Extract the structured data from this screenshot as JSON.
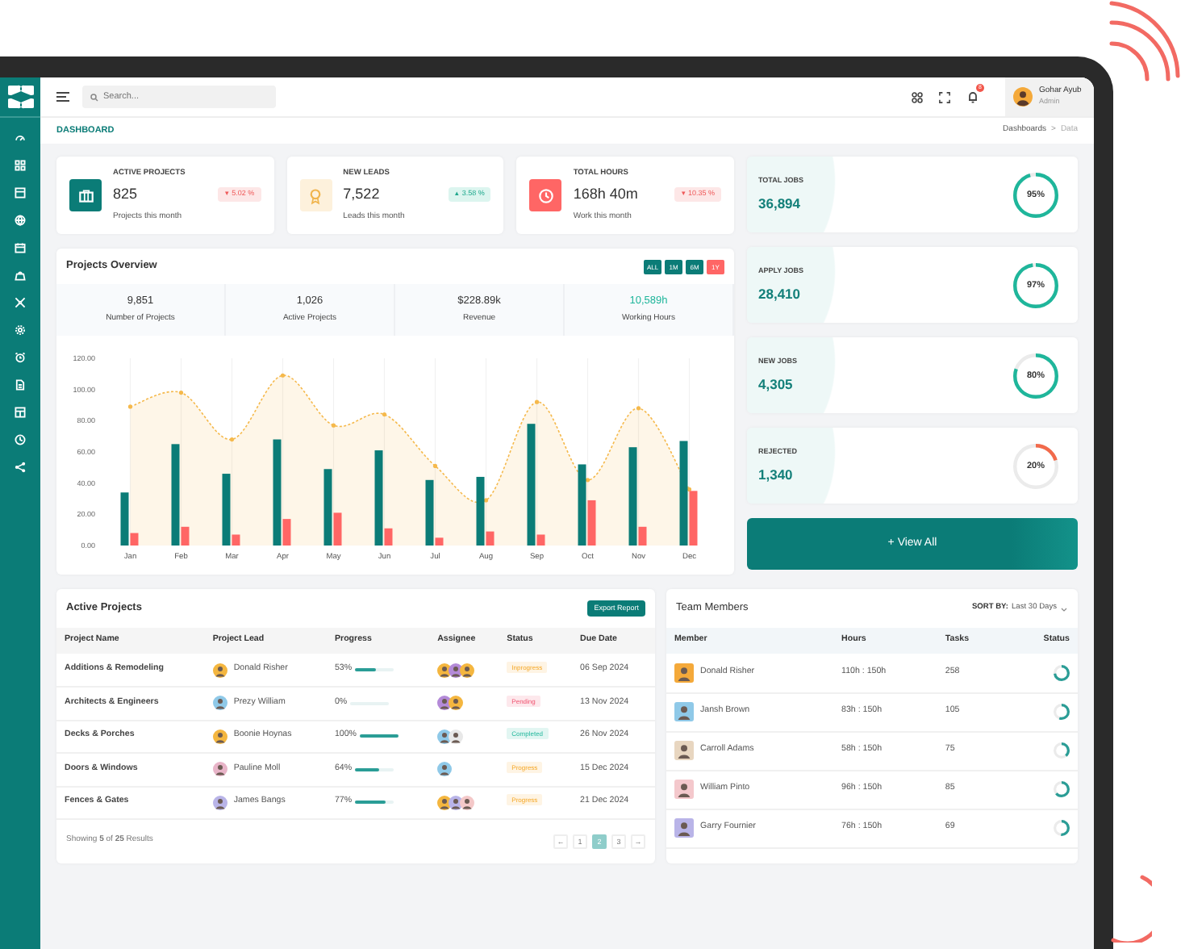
{
  "header": {
    "search": {
      "placeholder": "Search..."
    },
    "notification_badge": "8",
    "user": {
      "name": "Gohar Ayub",
      "role": "Admin"
    }
  },
  "breadcrumb": {
    "title": "DASHBOARD",
    "trail": [
      {
        "label": "Dashboards",
        "current": false
      },
      {
        "label": "Data",
        "current": true
      }
    ],
    "separator": ">"
  },
  "stat_cards": [
    {
      "title": "ACTIVE PROJECTS",
      "value": "825",
      "caption": "Projects this month",
      "change": "▾ 5.02 %",
      "kind": "down",
      "color": "#0b7c77"
    },
    {
      "title": "NEW LEADS",
      "value": "7,522",
      "caption": "Leads this month",
      "change": "▴ 3.58 %",
      "kind": "up",
      "color": "#fdf1dc"
    },
    {
      "title": "TOTAL HOURS",
      "value": "168h 40m",
      "caption": "Work this month",
      "change": "▾ 10.35 %",
      "kind": "down",
      "color": "#ff6665"
    }
  ],
  "projects_overview": {
    "title": "Projects Overview",
    "ranges": [
      {
        "label": "ALL",
        "selected": false
      },
      {
        "label": "1M",
        "selected": false
      },
      {
        "label": "6M",
        "selected": false
      },
      {
        "label": "1Y",
        "selected": true
      }
    ],
    "summary": [
      {
        "value": "9,851",
        "label": "Number of Projects",
        "highlight": false
      },
      {
        "value": "1,026",
        "label": "Active Projects",
        "highlight": false
      },
      {
        "value": "$228.89k",
        "label": "Revenue",
        "highlight": false
      },
      {
        "value": "10,589h",
        "label": "Working Hours",
        "highlight": true
      }
    ],
    "chart_data": {
      "type": "bar",
      "grid": true,
      "categories": [
        "Jan",
        "Feb",
        "Mar",
        "Apr",
        "May",
        "Jun",
        "Jul",
        "Aug",
        "Sep",
        "Oct",
        "Nov",
        "Dec"
      ],
      "ylim": [
        0,
        120
      ],
      "yticks": [
        {
          "value": 0,
          "label": "0.00"
        },
        {
          "value": 20,
          "label": "20.00"
        },
        {
          "value": 40,
          "label": "40.00"
        },
        {
          "value": 60,
          "label": "60.00"
        },
        {
          "value": 80,
          "label": "80.00"
        },
        {
          "value": 100,
          "label": "100.00"
        },
        {
          "value": 120,
          "label": "120.00"
        }
      ],
      "series": [
        {
          "type": "area",
          "color": "#f5b94c",
          "values": [
            89,
            98,
            68,
            109,
            77,
            84,
            51,
            29,
            92,
            42,
            88,
            36
          ]
        },
        {
          "type": "bar",
          "color": "#0b7c77",
          "values": [
            34,
            65,
            46,
            68,
            49,
            61,
            42,
            44,
            78,
            52,
            63,
            67
          ]
        },
        {
          "type": "bar",
          "color": "#ff6665",
          "values": [
            8,
            12,
            7,
            17,
            21,
            11,
            5,
            9,
            7,
            29,
            12,
            35
          ]
        }
      ]
    }
  },
  "job_cards": [
    {
      "title": "TOTAL JOBS",
      "value": "36,894",
      "percent": "95%",
      "level": 0.95,
      "color": "#1fb69b"
    },
    {
      "title": "APPLY JOBS",
      "value": "28,410",
      "percent": "97%",
      "level": 0.97,
      "color": "#1fb69b"
    },
    {
      "title": "NEW JOBS",
      "value": "4,305",
      "percent": "80%",
      "level": 0.8,
      "color": "#1fb69b"
    },
    {
      "title": "REJECTED",
      "value": "1,340",
      "percent": "20%",
      "level": 0.2,
      "color": "#f26a4b"
    }
  ],
  "view_all_button": "+ View All",
  "active_projects": {
    "title": "Active Projects",
    "export_button": "Export Report",
    "columns": [
      "Project Name",
      "Project Lead",
      "Progress",
      "Assignee",
      "Status",
      "Due Date"
    ],
    "rows": [
      {
        "name": "Additions & Remodeling",
        "lead": {
          "name": "Donald Risher",
          "color": "#f4b63f"
        },
        "progress": "53%",
        "level": 0.53,
        "assignees": [
          {
            "color": "#f4b63f"
          },
          {
            "color": "#b48ad8"
          },
          {
            "color": "#f4b63f"
          }
        ],
        "status": {
          "label": "Inprogress",
          "kind": "progress"
        },
        "due": "06 Sep 2024"
      },
      {
        "name": "Architects & Engineers",
        "lead": {
          "name": "Prezy William",
          "color": "#8fc9e8"
        },
        "progress": "0%",
        "level": 0,
        "assignees": [
          {
            "color": "#b48ad8"
          },
          {
            "color": "#f4b63f"
          }
        ],
        "status": {
          "label": "Pending",
          "kind": "pending"
        },
        "due": "13 Nov 2024"
      },
      {
        "name": "Decks & Porches",
        "lead": {
          "name": "Boonie Hoynas",
          "color": "#f4b63f"
        },
        "progress": "100%",
        "level": 1,
        "assignees": [
          {
            "color": "#8fc9e8"
          },
          {
            "color": "#e8e8e8"
          }
        ],
        "status": {
          "label": "Completed",
          "kind": "completed"
        },
        "due": "26 Nov 2024"
      },
      {
        "name": "Doors & Windows",
        "lead": {
          "name": "Pauline Moll",
          "color": "#e8b4c8"
        },
        "progress": "64%",
        "level": 0.64,
        "assignees": [
          {
            "color": "#8fc9e8"
          }
        ],
        "status": {
          "label": "Progress",
          "kind": "progress"
        },
        "due": "15 Dec 2024"
      },
      {
        "name": "Fences & Gates",
        "lead": {
          "name": "James Bangs",
          "color": "#b9b4e8"
        },
        "progress": "77%",
        "level": 0.77,
        "assignees": [
          {
            "color": "#f4b63f"
          },
          {
            "color": "#b9b4e8"
          },
          {
            "color": "#f4c8c8"
          }
        ],
        "status": {
          "label": "Progress",
          "kind": "progress"
        },
        "due": "21 Dec 2024"
      }
    ],
    "footer": "Showing **5** of **25** Results",
    "pages": [
      {
        "label": "←",
        "selected": false
      },
      {
        "label": "1",
        "selected": false
      },
      {
        "label": "2",
        "selected": true
      },
      {
        "label": "3",
        "selected": false
      },
      {
        "label": "→",
        "selected": false
      }
    ]
  },
  "team_members": {
    "title": "Team Members",
    "sort_label": "SORT BY:",
    "sort_value": "Last 30 Days",
    "columns": [
      "Member",
      "Hours",
      "Tasks",
      "Status"
    ],
    "rows": [
      {
        "name": "Donald Risher",
        "color": "#f4a93a",
        "hours": "110h : 150h",
        "tasks": "258",
        "level": 0.73
      },
      {
        "name": "Jansh Brown",
        "color": "#8fc9e8",
        "hours": "83h : 150h",
        "tasks": "105",
        "level": 0.55
      },
      {
        "name": "Carroll Adams",
        "color": "#e8d6c0",
        "hours": "58h : 150h",
        "tasks": "75",
        "level": 0.39
      },
      {
        "name": "William Pinto",
        "color": "#f4c8cc",
        "hours": "96h : 150h",
        "tasks": "85",
        "level": 0.64
      },
      {
        "name": "Garry Fournier",
        "color": "#b9b4e8",
        "hours": "76h : 150h",
        "tasks": "69",
        "level": 0.51
      }
    ]
  }
}
